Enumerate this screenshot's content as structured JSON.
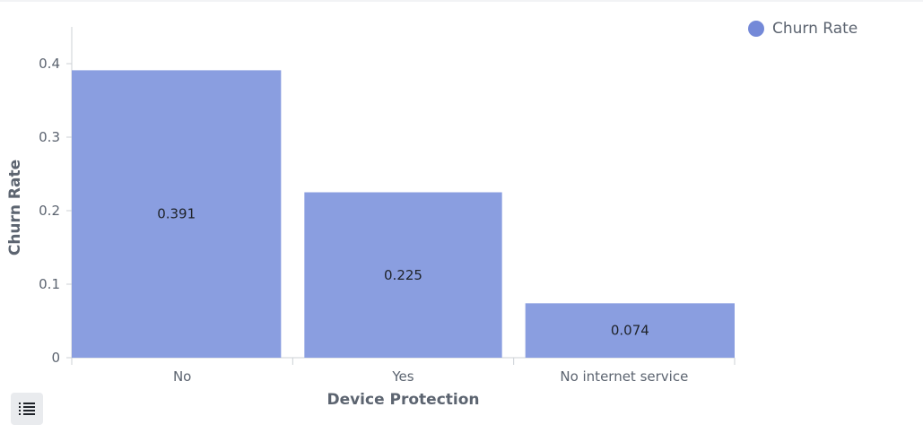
{
  "chart_data": {
    "type": "bar",
    "categories": [
      "No",
      "Yes",
      "No internet service"
    ],
    "series": [
      {
        "name": "Churn Rate",
        "values": [
          0.391,
          0.225,
          0.074
        ],
        "color": "#8a9ee0"
      }
    ],
    "value_labels": [
      "0.391",
      "0.225",
      "0.074"
    ],
    "xlabel": "Device Protection",
    "ylabel": "Churn Rate",
    "ylim": [
      0,
      0.45
    ],
    "yticks": [
      0,
      0.1,
      0.2,
      0.3,
      0.4
    ],
    "ytick_labels": [
      "0",
      "0.1",
      "0.2",
      "0.3",
      "0.4"
    ],
    "legend_position": "top-right",
    "grid": false
  },
  "legend": {
    "label": "Churn Rate",
    "color": "#7489d8"
  },
  "toolbar": {
    "menu_icon": "list-icon"
  }
}
